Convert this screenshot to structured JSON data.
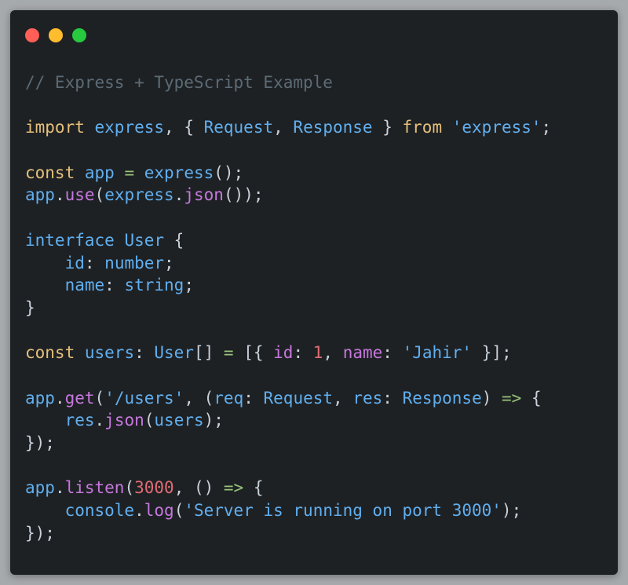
{
  "window": {
    "controls": [
      {
        "name": "close",
        "color": "#ff5f56"
      },
      {
        "name": "minimize",
        "color": "#ffbd2e"
      },
      {
        "name": "maximize",
        "color": "#27c93f"
      }
    ]
  },
  "code_lines": [
    [
      {
        "t": "// Express + TypeScript Example",
        "c": "comment"
      }
    ],
    [],
    [
      {
        "t": "import",
        "c": "kw"
      },
      {
        "t": " ",
        "c": "punct"
      },
      {
        "t": "express",
        "c": "ident"
      },
      {
        "t": ", { ",
        "c": "punct"
      },
      {
        "t": "Request",
        "c": "ident"
      },
      {
        "t": ", ",
        "c": "punct"
      },
      {
        "t": "Response",
        "c": "ident"
      },
      {
        "t": " } ",
        "c": "punct"
      },
      {
        "t": "from",
        "c": "kw"
      },
      {
        "t": " ",
        "c": "punct"
      },
      {
        "t": "'express'",
        "c": "str"
      },
      {
        "t": ";",
        "c": "punct"
      }
    ],
    [],
    [
      {
        "t": "const",
        "c": "kw"
      },
      {
        "t": " ",
        "c": "punct"
      },
      {
        "t": "app",
        "c": "ident"
      },
      {
        "t": " = ",
        "c": "op"
      },
      {
        "t": "express",
        "c": "ident"
      },
      {
        "t": "();",
        "c": "punct"
      }
    ],
    [
      {
        "t": "app",
        "c": "ident"
      },
      {
        "t": ".",
        "c": "punct"
      },
      {
        "t": "use",
        "c": "prop"
      },
      {
        "t": "(",
        "c": "punct"
      },
      {
        "t": "express",
        "c": "ident"
      },
      {
        "t": ".",
        "c": "punct"
      },
      {
        "t": "json",
        "c": "prop"
      },
      {
        "t": "());",
        "c": "punct"
      }
    ],
    [],
    [
      {
        "t": "interface",
        "c": "ident"
      },
      {
        "t": " ",
        "c": "punct"
      },
      {
        "t": "User",
        "c": "ident"
      },
      {
        "t": " {",
        "c": "punct"
      }
    ],
    [
      {
        "t": "    ",
        "c": "punct"
      },
      {
        "t": "id",
        "c": "ident"
      },
      {
        "t": ": ",
        "c": "punct"
      },
      {
        "t": "number",
        "c": "ident"
      },
      {
        "t": ";",
        "c": "punct"
      }
    ],
    [
      {
        "t": "    ",
        "c": "punct"
      },
      {
        "t": "name",
        "c": "ident"
      },
      {
        "t": ": ",
        "c": "punct"
      },
      {
        "t": "string",
        "c": "ident"
      },
      {
        "t": ";",
        "c": "punct"
      }
    ],
    [
      {
        "t": "}",
        "c": "punct"
      }
    ],
    [],
    [
      {
        "t": "const",
        "c": "kw"
      },
      {
        "t": " ",
        "c": "punct"
      },
      {
        "t": "users",
        "c": "ident"
      },
      {
        "t": ": ",
        "c": "punct"
      },
      {
        "t": "User",
        "c": "ident"
      },
      {
        "t": "[] ",
        "c": "punct"
      },
      {
        "t": "=",
        "c": "op"
      },
      {
        "t": " [{ ",
        "c": "punct"
      },
      {
        "t": "id",
        "c": "prop"
      },
      {
        "t": ": ",
        "c": "punct"
      },
      {
        "t": "1",
        "c": "num"
      },
      {
        "t": ", ",
        "c": "punct"
      },
      {
        "t": "name",
        "c": "prop"
      },
      {
        "t": ": ",
        "c": "punct"
      },
      {
        "t": "'Jahir'",
        "c": "str"
      },
      {
        "t": " }];",
        "c": "punct"
      }
    ],
    [],
    [
      {
        "t": "app",
        "c": "ident"
      },
      {
        "t": ".",
        "c": "punct"
      },
      {
        "t": "get",
        "c": "prop"
      },
      {
        "t": "(",
        "c": "punct"
      },
      {
        "t": "'/users'",
        "c": "str"
      },
      {
        "t": ", (",
        "c": "punct"
      },
      {
        "t": "req",
        "c": "ident"
      },
      {
        "t": ": ",
        "c": "punct"
      },
      {
        "t": "Request",
        "c": "ident"
      },
      {
        "t": ", ",
        "c": "punct"
      },
      {
        "t": "res",
        "c": "ident"
      },
      {
        "t": ": ",
        "c": "punct"
      },
      {
        "t": "Response",
        "c": "ident"
      },
      {
        "t": ") ",
        "c": "punct"
      },
      {
        "t": "=>",
        "c": "op"
      },
      {
        "t": " {",
        "c": "punct"
      }
    ],
    [
      {
        "t": "    ",
        "c": "punct"
      },
      {
        "t": "res",
        "c": "ident"
      },
      {
        "t": ".",
        "c": "punct"
      },
      {
        "t": "json",
        "c": "prop"
      },
      {
        "t": "(",
        "c": "punct"
      },
      {
        "t": "users",
        "c": "ident"
      },
      {
        "t": ");",
        "c": "punct"
      }
    ],
    [
      {
        "t": "});",
        "c": "punct"
      }
    ],
    [],
    [
      {
        "t": "app",
        "c": "ident"
      },
      {
        "t": ".",
        "c": "punct"
      },
      {
        "t": "listen",
        "c": "prop"
      },
      {
        "t": "(",
        "c": "punct"
      },
      {
        "t": "3000",
        "c": "num"
      },
      {
        "t": ", () ",
        "c": "punct"
      },
      {
        "t": "=>",
        "c": "op"
      },
      {
        "t": " {",
        "c": "punct"
      }
    ],
    [
      {
        "t": "    ",
        "c": "punct"
      },
      {
        "t": "console",
        "c": "ident"
      },
      {
        "t": ".",
        "c": "punct"
      },
      {
        "t": "log",
        "c": "prop"
      },
      {
        "t": "(",
        "c": "punct"
      },
      {
        "t": "'Server is running on port 3000'",
        "c": "str"
      },
      {
        "t": ");",
        "c": "punct"
      }
    ],
    [
      {
        "t": "});",
        "c": "punct"
      }
    ]
  ]
}
